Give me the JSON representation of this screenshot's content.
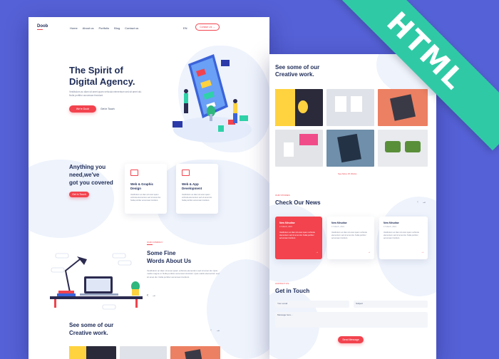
{
  "badge": {
    "label": "HTML"
  },
  "brand": {
    "logo": "Doob"
  },
  "nav": {
    "items": [
      "Home",
      "About us",
      "Portfolio",
      "Blog",
      "Contact us"
    ],
    "lang": "EN",
    "cta": "Contact Us"
  },
  "hero": {
    "title_line1": "The Spirit of",
    "title_line2": "Digital Agency.",
    "text": "Vestibulum ac diam sit amet quam vehicula elementum sed sit amet dui. Nulla porttitor accumsan tincidunt.",
    "primary_btn": "We're Doob",
    "secondary_btn": "Get in Touch"
  },
  "services": {
    "heading_line1": "Anything you",
    "heading_line2": "need,we've",
    "heading_line3": "got you covered",
    "btn": "Get in Touch",
    "cards": [
      {
        "title_line1": "Web & Graphic",
        "title_line2": "Design",
        "text": "Vestibulum ac diam sit amet quam vehicula elementum sed sit amet dui. Nulla porttitor accumsan tincidunt."
      },
      {
        "title_line1": "Web & App",
        "title_line2": "Development",
        "text": "Vestibulum ac diam sit amet quam vehicula elementum sed sit amet dui. Nulla porttitor accumsan tincidunt."
      }
    ]
  },
  "about": {
    "eyebrow": "OUR COMPANY",
    "heading_line1": "Some Fine",
    "heading_line2": "Words About Us",
    "text": "Vestibulum ac diam sit amet quam vehicula elementum sed sit amet dui. Quis mattis magna ut. Nulla porttitor accumsan tincidunt. Quis mattis elementum sed sit amet dui. Nulla porttitor accumsan tincidunt."
  },
  "portfolio": {
    "heading_line1": "See some of our",
    "heading_line2": "Creative work.",
    "see_more": "See More Of Works",
    "arrow_prev": "‹",
    "arrow_next": "→"
  },
  "news": {
    "eyebrow": "OUR STORIES",
    "heading": "Check Our News",
    "cards": [
      {
        "title": "New Minutiae",
        "date": "17 March, 2021",
        "text": "Vestibulum ac diam sit amet quam vehicula elementum sed sit amet dui. Nulla porttitor accumsan tincidunt."
      },
      {
        "title": "New Minutiae",
        "date": "17 March, 2021",
        "text": "Vestibulum ac diam sit amet quam vehicula elementum sed sit amet dui. Nulla porttitor accumsan tincidunt."
      },
      {
        "title": "New Minutiae",
        "date": "17 March, 2021",
        "text": "Vestibulum ac diam sit amet quam vehicula elementum sed sit amet dui. Nulla porttitor accumsan tincidunt."
      }
    ]
  },
  "contact": {
    "eyebrow": "CONTACT US",
    "heading": "Get in Touch",
    "email_placeholder": "Your email",
    "subject_placeholder": "Subject",
    "message_placeholder": "Message here...",
    "send_btn": "Send Message"
  },
  "colors": {
    "accent": "#f2434e",
    "navy": "#1e2c57",
    "frame": "#5561d6",
    "ribbon": "#30c9a6"
  }
}
